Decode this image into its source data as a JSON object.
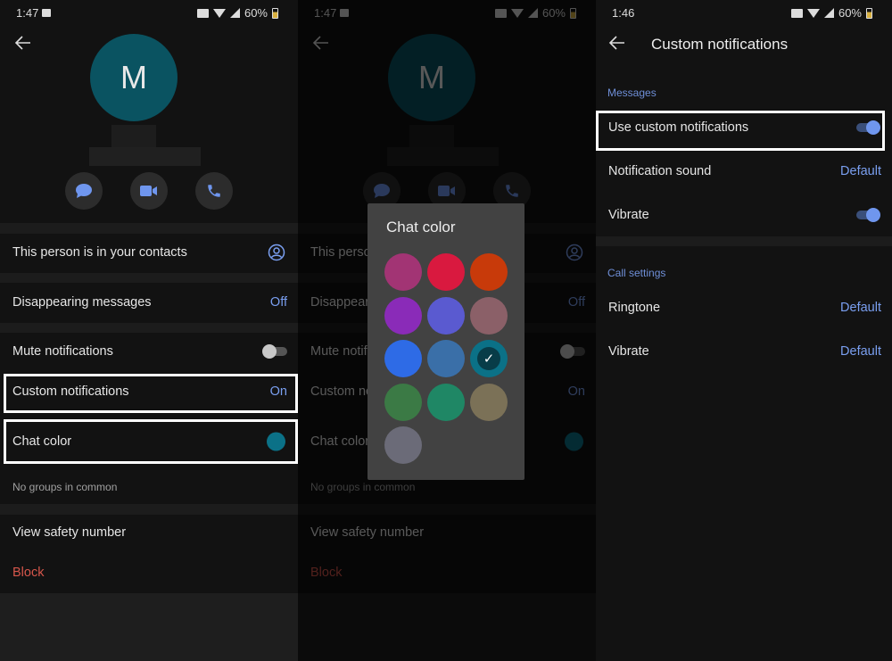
{
  "contact_screen": {
    "status": {
      "time": "1:47",
      "battery": "60%"
    },
    "avatar_initial": "M",
    "actions": [
      {
        "icon": "message-icon"
      },
      {
        "icon": "video-call-icon"
      },
      {
        "icon": "phone-icon"
      }
    ],
    "rows": {
      "contacts": "This person is in your contacts",
      "disappearing": "Disappearing messages",
      "disappearing_value": "Off",
      "mute": "Mute notifications",
      "mute_on": false,
      "custom": "Custom notifications",
      "custom_value": "On",
      "chat_color": "Chat color",
      "chat_color_value": "#0b7187",
      "groups": "No groups in common",
      "safety": "View safety number",
      "block": "Block"
    }
  },
  "chat_color_dialog": {
    "title": "Chat color",
    "selected": "#0b7187",
    "colors": [
      "#a23474",
      "#d9193f",
      "#c83a0a",
      "#8a2bb8",
      "#5a5ad0",
      "#8b6068",
      "#2e6be6",
      "#3a6fa8",
      "#0b7187",
      "#3b7a45",
      "#1f8765",
      "#7b7157",
      "#6b6b78"
    ]
  },
  "custom_notifications_screen": {
    "status": {
      "time": "1:46",
      "battery": "60%"
    },
    "title": "Custom notifications",
    "messages_header": "Messages",
    "use_custom": "Use custom notifications",
    "use_custom_on": true,
    "notification_sound": "Notification sound",
    "notification_sound_value": "Default",
    "vibrate": "Vibrate",
    "vibrate_on": true,
    "call_header": "Call settings",
    "ringtone": "Ringtone",
    "ringtone_value": "Default",
    "call_vibrate": "Vibrate",
    "call_vibrate_value": "Default"
  },
  "accent": "#7a9ff0"
}
